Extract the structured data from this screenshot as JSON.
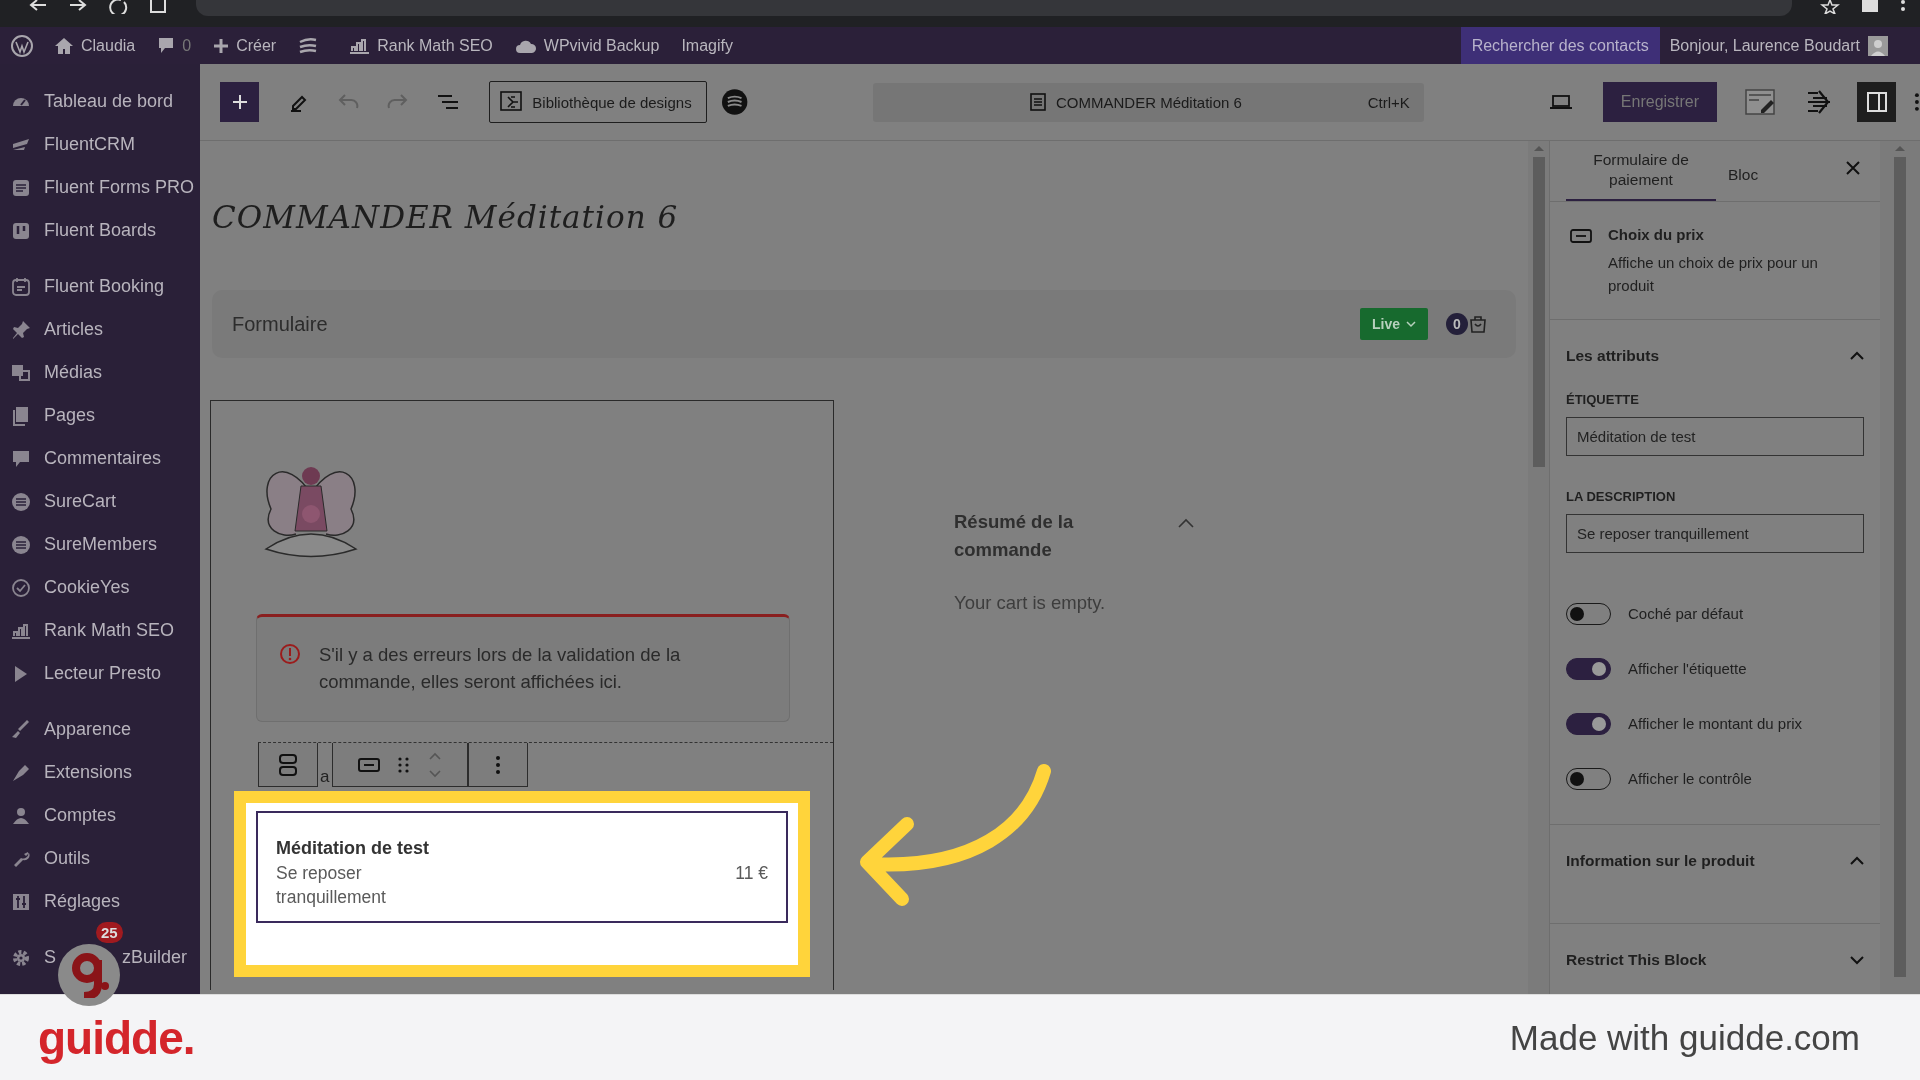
{
  "admin_bar": {
    "site": "Claudia",
    "comments": "0",
    "new": "Créer",
    "rank_math": "Rank Math SEO",
    "backup": "WPvivid Backup",
    "imagify": "Imagify",
    "search_contacts": "Rechercher des contacts",
    "greeting": "Bonjour, Laurence Boudart"
  },
  "sidebar": {
    "groups": [
      [
        {
          "label": "Tableau de bord"
        },
        {
          "label": "FluentCRM"
        },
        {
          "label": "Fluent Forms PRO"
        },
        {
          "label": "Fluent Boards"
        }
      ],
      [
        {
          "label": "Fluent Booking"
        },
        {
          "label": "Articles"
        },
        {
          "label": "Médias"
        },
        {
          "label": "Pages"
        },
        {
          "label": "Commentaires"
        },
        {
          "label": "SureCart"
        },
        {
          "label": "SureMembers"
        },
        {
          "label": "CookieYes"
        },
        {
          "label": "Rank Math SEO"
        },
        {
          "label": "Lecteur Presto"
        }
      ],
      [
        {
          "label": "Apparence"
        },
        {
          "label": "Extensions"
        },
        {
          "label": "Comptes"
        },
        {
          "label": "Outils"
        },
        {
          "label": "Réglages"
        }
      ],
      [
        {
          "label_parts": [
            "S",
            "zBuilder"
          ]
        }
      ]
    ]
  },
  "toolbar": {
    "design_library": "Bibliothèque de designs",
    "document_title": "COMMANDER Méditation 6",
    "shortcut": "Ctrl+K",
    "save": "Enregistrer"
  },
  "canvas": {
    "page_title": "COMMANDER Méditation 6",
    "form_header": {
      "label": "Formulaire",
      "status": "Live",
      "cart_count": "0"
    },
    "error_notice": "S'il y a des erreurs lors de la validation de la commande, elles seront affichées ici.",
    "block_toolbar": {
      "partial_text": "a"
    },
    "price_choice": {
      "name": "Méditation de test",
      "description": "Se reposer tranquillement",
      "price": "11 €"
    },
    "summary": {
      "title": "Résumé de la commande",
      "expanded": true,
      "empty_text": "Your cart is empty."
    }
  },
  "panel": {
    "tabs": [
      {
        "label": "Formulaire de paiement",
        "selected": true
      },
      {
        "label": "Bloc",
        "selected": false
      }
    ],
    "block": {
      "title": "Choix du prix",
      "description": "Affiche un choix de prix pour un produit"
    },
    "sections": [
      {
        "title": "Les attributs",
        "expanded": true
      },
      {
        "title": "Information sur le produit",
        "expanded": true
      },
      {
        "title": "Restrict This Block",
        "expanded": false
      }
    ],
    "fields": [
      {
        "label": "ÉTIQUETTE",
        "value": "Méditation de test"
      },
      {
        "label": "LA DESCRIPTION",
        "value": "Se reposer tranquillement"
      }
    ],
    "toggles": [
      {
        "label": "Coché par défaut",
        "on": false
      },
      {
        "label": "Afficher l'étiquette",
        "on": true
      },
      {
        "label": "Afficher le montant du prix",
        "on": true
      },
      {
        "label": "Afficher le contrôle",
        "on": false
      }
    ]
  },
  "guidde": {
    "notification_count": "25",
    "logo": "guidde.",
    "credit": "Made with guidde.com"
  }
}
